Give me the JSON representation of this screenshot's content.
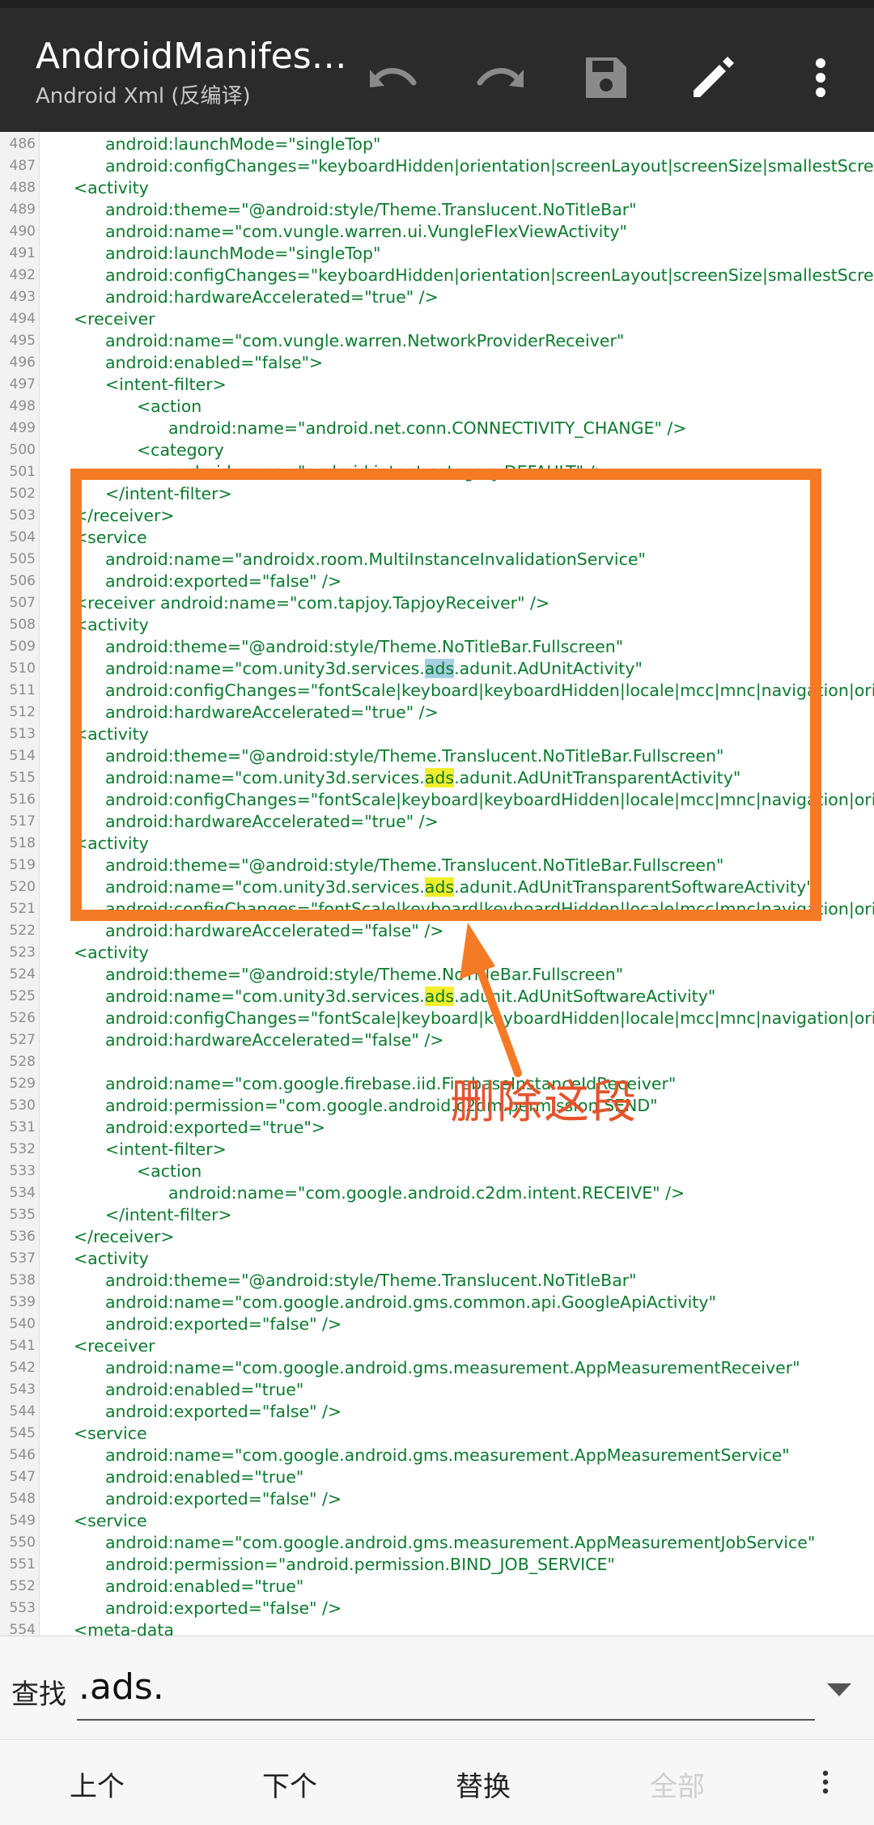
{
  "app": {
    "title": "AndroidManifes…",
    "subtitle": "Android Xml (反编译)"
  },
  "toolbar": {
    "undo_icon": "undo-icon",
    "redo_icon": "redo-icon",
    "save_icon": "save-icon",
    "edit_icon": "pencil-icon",
    "more_icon": "more-vert-icon"
  },
  "code_lines": [
    {
      "n": "486",
      "indent": 2,
      "text": "android:launchMode=\"singleTop\""
    },
    {
      "n": "487",
      "indent": 2,
      "text": "android:configChanges=\"keyboardHidden|orientation|screenLayout|screenSize|smallestScreenSiz"
    },
    {
      "n": "488",
      "indent": 1,
      "text": "<activity"
    },
    {
      "n": "489",
      "indent": 2,
      "text": "android:theme=\"@android:style/Theme.Translucent.NoTitleBar\""
    },
    {
      "n": "490",
      "indent": 2,
      "text": "android:name=\"com.vungle.warren.ui.VungleFlexViewActivity\""
    },
    {
      "n": "491",
      "indent": 2,
      "text": "android:launchMode=\"singleTop\""
    },
    {
      "n": "492",
      "indent": 2,
      "text": "android:configChanges=\"keyboardHidden|orientation|screenLayout|screenSize|smallestScreenSiz"
    },
    {
      "n": "493",
      "indent": 2,
      "text": "android:hardwareAccelerated=\"true\" />"
    },
    {
      "n": "494",
      "indent": 1,
      "text": "<receiver"
    },
    {
      "n": "495",
      "indent": 2,
      "text": "android:name=\"com.vungle.warren.NetworkProviderReceiver\""
    },
    {
      "n": "496",
      "indent": 2,
      "text": "android:enabled=\"false\">"
    },
    {
      "n": "497",
      "indent": 2,
      "text": "<intent-filter>"
    },
    {
      "n": "498",
      "indent": 3,
      "text": "<action"
    },
    {
      "n": "499",
      "indent": 4,
      "text": "android:name=\"android.net.conn.CONNECTIVITY_CHANGE\" />"
    },
    {
      "n": "500",
      "indent": 3,
      "text": "<category"
    },
    {
      "n": "501",
      "indent": 4,
      "text": "android:name=\"android.intent.category.DEFAULT\" />"
    },
    {
      "n": "502",
      "indent": 2,
      "text": "</intent-filter>"
    },
    {
      "n": "503",
      "indent": 1,
      "text": "</receiver>"
    },
    {
      "n": "504",
      "indent": 1,
      "text": "<service"
    },
    {
      "n": "505",
      "indent": 2,
      "text": "android:name=\"androidx.room.MultiInstanceInvalidationService\""
    },
    {
      "n": "506",
      "indent": 2,
      "text": "android:exported=\"false\" />"
    },
    {
      "n": "507",
      "indent": 1,
      "text": "<receiver android:name=\"com.tapjoy.TapjoyReceiver\" />"
    },
    {
      "n": "508",
      "indent": 1,
      "text": "<activity"
    },
    {
      "n": "509",
      "indent": 2,
      "text": "android:theme=\"@android:style/Theme.NoTitleBar.Fullscreen\""
    },
    {
      "n": "510",
      "indent": 2,
      "pre": "android:name=\"com.unity3d.services.",
      "match": "ads",
      "post": ".adunit.AdUnitActivity\"",
      "current": true
    },
    {
      "n": "511",
      "indent": 2,
      "text": "android:configChanges=\"fontScale|keyboard|keyboardHidden|locale|mcc|mnc|navigation|orientat"
    },
    {
      "n": "512",
      "indent": 2,
      "text": "android:hardwareAccelerated=\"true\" />"
    },
    {
      "n": "513",
      "indent": 1,
      "text": "<activity"
    },
    {
      "n": "514",
      "indent": 2,
      "text": "android:theme=\"@android:style/Theme.Translucent.NoTitleBar.Fullscreen\""
    },
    {
      "n": "515",
      "indent": 2,
      "pre": "android:name=\"com.unity3d.services.",
      "match": "ads",
      "post": ".adunit.AdUnitTransparentActivity\""
    },
    {
      "n": "516",
      "indent": 2,
      "text": "android:configChanges=\"fontScale|keyboard|keyboardHidden|locale|mcc|mnc|navigation|orientat"
    },
    {
      "n": "517",
      "indent": 2,
      "text": "android:hardwareAccelerated=\"true\" />"
    },
    {
      "n": "518",
      "indent": 1,
      "text": "<activity"
    },
    {
      "n": "519",
      "indent": 2,
      "text": "android:theme=\"@android:style/Theme.Translucent.NoTitleBar.Fullscreen\""
    },
    {
      "n": "520",
      "indent": 2,
      "pre": "android:name=\"com.unity3d.services.",
      "match": "ads",
      "post": ".adunit.AdUnitTransparentSoftwareActivity\""
    },
    {
      "n": "521",
      "indent": 2,
      "text": "android:configChanges=\"fontScale|keyboard|keyboardHidden|locale|mcc|mnc|navigation|orientat"
    },
    {
      "n": "522",
      "indent": 2,
      "text": "android:hardwareAccelerated=\"false\" />"
    },
    {
      "n": "523",
      "indent": 1,
      "text": "<activity"
    },
    {
      "n": "524",
      "indent": 2,
      "text": "android:theme=\"@android:style/Theme.NoTitleBar.Fullscreen\""
    },
    {
      "n": "525",
      "indent": 2,
      "pre": "android:name=\"com.unity3d.services.",
      "match": "ads",
      "post": ".adunit.AdUnitSoftwareActivity\""
    },
    {
      "n": "526",
      "indent": 2,
      "text": "android:configChanges=\"fontScale|keyboard|keyboardHidden|locale|mcc|mnc|navigation|orientat"
    },
    {
      "n": "527",
      "indent": 2,
      "text": "android:hardwareAccelerated=\"false\" />"
    },
    {
      "n": "528",
      "indent": 1,
      "text": ""
    },
    {
      "n": "529",
      "indent": 2,
      "text": "android:name=\"com.google.firebase.iid.FirebaseInstanceIdReceiver\""
    },
    {
      "n": "530",
      "indent": 2,
      "text": "android:permission=\"com.google.android.c2dm.permission.SEND\""
    },
    {
      "n": "531",
      "indent": 2,
      "text": "android:exported=\"true\">"
    },
    {
      "n": "532",
      "indent": 2,
      "text": "<intent-filter>"
    },
    {
      "n": "533",
      "indent": 3,
      "text": "<action"
    },
    {
      "n": "534",
      "indent": 4,
      "text": "android:name=\"com.google.android.c2dm.intent.RECEIVE\" />"
    },
    {
      "n": "535",
      "indent": 2,
      "text": "</intent-filter>"
    },
    {
      "n": "536",
      "indent": 1,
      "text": "</receiver>"
    },
    {
      "n": "537",
      "indent": 1,
      "text": "<activity"
    },
    {
      "n": "538",
      "indent": 2,
      "text": "android:theme=\"@android:style/Theme.Translucent.NoTitleBar\""
    },
    {
      "n": "539",
      "indent": 2,
      "text": "android:name=\"com.google.android.gms.common.api.GoogleApiActivity\""
    },
    {
      "n": "540",
      "indent": 2,
      "text": "android:exported=\"false\" />"
    },
    {
      "n": "541",
      "indent": 1,
      "text": "<receiver"
    },
    {
      "n": "542",
      "indent": 2,
      "text": "android:name=\"com.google.android.gms.measurement.AppMeasurementReceiver\""
    },
    {
      "n": "543",
      "indent": 2,
      "text": "android:enabled=\"true\""
    },
    {
      "n": "544",
      "indent": 2,
      "text": "android:exported=\"false\" />"
    },
    {
      "n": "545",
      "indent": 1,
      "text": "<service"
    },
    {
      "n": "546",
      "indent": 2,
      "text": "android:name=\"com.google.android.gms.measurement.AppMeasurementService\""
    },
    {
      "n": "547",
      "indent": 2,
      "text": "android:enabled=\"true\""
    },
    {
      "n": "548",
      "indent": 2,
      "text": "android:exported=\"false\" />"
    },
    {
      "n": "549",
      "indent": 1,
      "text": "<service"
    },
    {
      "n": "550",
      "indent": 2,
      "text": "android:name=\"com.google.android.gms.measurement.AppMeasurementJobService\""
    },
    {
      "n": "551",
      "indent": 2,
      "text": "android:permission=\"android.permission.BIND_JOB_SERVICE\""
    },
    {
      "n": "552",
      "indent": 2,
      "text": "android:enabled=\"true\""
    },
    {
      "n": "553",
      "indent": 2,
      "text": "android:exported=\"false\" />"
    },
    {
      "n": "554",
      "indent": 1,
      "text": "<meta-data"
    }
  ],
  "annotation": {
    "label": "删除这段",
    "color": "#f57a25"
  },
  "search": {
    "label": "查找",
    "value": ".ads.",
    "dropdown_icon": "dropdown-triangle-icon"
  },
  "actions": {
    "prev": "上个",
    "next": "下个",
    "replace": "替换",
    "all": "全部",
    "more_icon": "more-vert-icon"
  },
  "colors": {
    "appbar": "#2b2b2b",
    "code": "#0b7a2e",
    "match_highlight": "#f3ee2a",
    "current_match": "#a6cfe3",
    "annotation_text": "#e5532b"
  }
}
